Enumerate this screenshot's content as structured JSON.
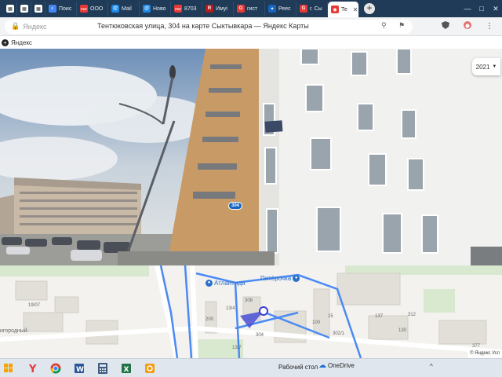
{
  "browser": {
    "tabs": [
      {
        "label": "",
        "icon": "grid-icon",
        "color": "#ffffff"
      },
      {
        "label": "",
        "icon": "grid-icon",
        "color": "#ffffff"
      },
      {
        "label": "",
        "icon": "grid-icon",
        "color": "#ffffff"
      },
      {
        "label": "Поис",
        "icon": "browser-icon",
        "color": "#4285f4"
      },
      {
        "label": "ООО",
        "icon": "pdf-icon",
        "color": "#e53935"
      },
      {
        "label": "Mail",
        "icon": "at-icon",
        "color": "#1e88e5"
      },
      {
        "label": "Ново",
        "icon": "at-icon",
        "color": "#1e88e5"
      },
      {
        "label": "8703",
        "icon": "pdf-icon",
        "color": "#e53935"
      },
      {
        "label": "Имуі",
        "icon": "rbc-icon",
        "color": "#b71c1c"
      },
      {
        "label": "гист",
        "icon": "google-icon",
        "color": "#e53935"
      },
      {
        "label": "Реес",
        "icon": "eagle-icon",
        "color": "#1565c0"
      },
      {
        "label": "г. Сы",
        "icon": "google-icon",
        "color": "#e53935"
      },
      {
        "label": "Те",
        "icon": "map-pin-icon",
        "color": "#e53935",
        "active": true
      }
    ],
    "new_tab": "+",
    "address": {
      "site": "Яндекс",
      "title": "Тентюковская улица, 304 на карте Сыктывкара — Яндекс Карты"
    },
    "bookmark": "Яндекс"
  },
  "panorama": {
    "year": "2021",
    "house_number": "304"
  },
  "map": {
    "poi": [
      {
        "name": "Атлантида"
      },
      {
        "name": "Пятёрочка"
      }
    ],
    "labels": {
      "district": "игородный",
      "l1": "19/07",
      "l2": "308",
      "l3": "200",
      "l4": "13/4",
      "l5": "100",
      "l6": "15",
      "l7": "304",
      "l8": "302/1",
      "l9": "13/7",
      "l10": "130",
      "l11": "137",
      "l12": "312",
      "l13": "377"
    },
    "copyright": "© Яндекс  Усл"
  },
  "taskbar": {
    "desktop_label": "Рабочий стол",
    "onedrive_label": "OneDrive",
    "tray_chevron": "^"
  },
  "colors": {
    "route": "#4285f4",
    "titlebar": "#1f3b57"
  }
}
